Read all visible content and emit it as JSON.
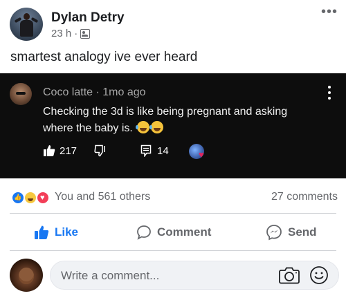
{
  "post": {
    "author": "Dylan Detry",
    "time": "23 h",
    "separator": "·",
    "text": "smartest analogy ive ever heard"
  },
  "shared": {
    "author": "Coco latte",
    "separator": "·",
    "age": "1mo ago",
    "comment": "Checking the 3d is like being pregnant and asking where the baby is.",
    "likes": "217",
    "replies": "14"
  },
  "reactions": {
    "summary": "You and 561 others",
    "comments": "27 comments"
  },
  "actions": {
    "like": "Like",
    "comment": "Comment",
    "send": "Send"
  },
  "composer": {
    "placeholder": "Write a comment..."
  },
  "colors": {
    "accent": "#1877f2",
    "muted": "#65676b",
    "card_bg": "#0d0d0d"
  },
  "icons": [
    "more-icon",
    "friends-audience-icon",
    "kebab-icon",
    "thumbs-up-icon",
    "thumbs-down-icon",
    "reply-icon",
    "heart-icon",
    "like-reaction-icon",
    "haha-reaction-icon",
    "love-reaction-icon",
    "comment-icon",
    "messenger-icon",
    "camera-icon",
    "emoji-icon"
  ]
}
